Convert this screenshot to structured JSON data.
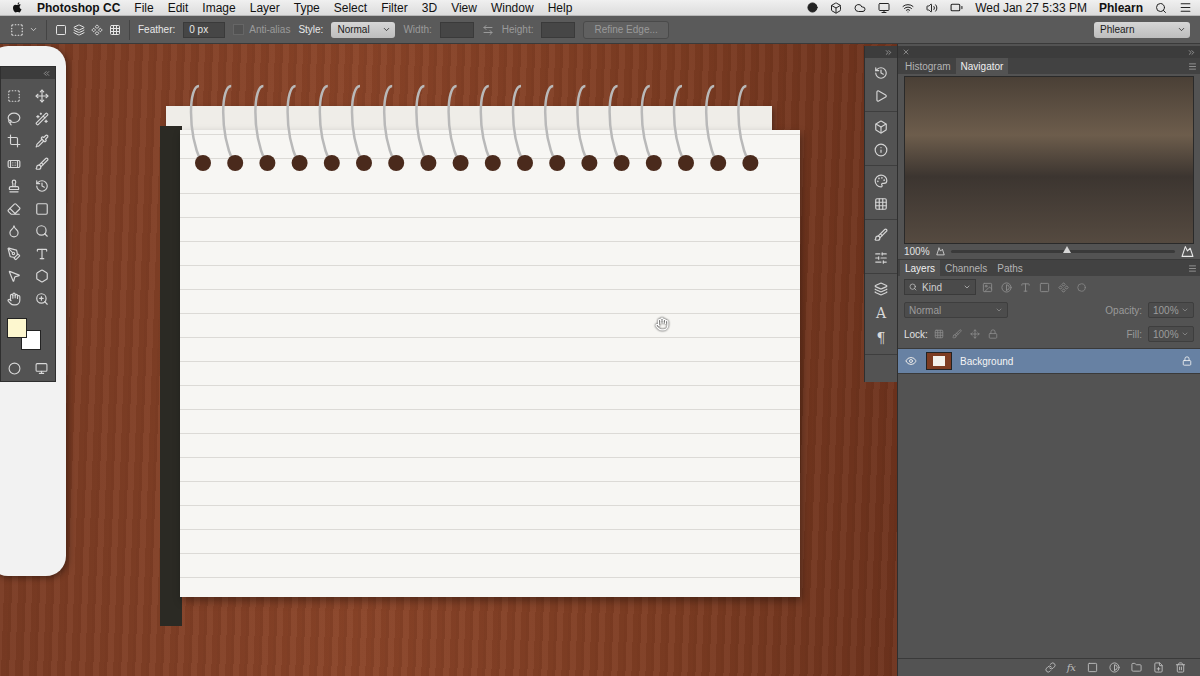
{
  "menu_bar": {
    "app": "Photoshop CC",
    "items": [
      "File",
      "Edit",
      "Image",
      "Layer",
      "Type",
      "Select",
      "Filter",
      "3D",
      "View",
      "Window",
      "Help"
    ],
    "clock": "Wed Jan 27 5:33 PM",
    "user": "Phlearn"
  },
  "options_bar": {
    "feather_label": "Feather:",
    "feather_value": "0 px",
    "anti_alias": {
      "label": "Anti-alias",
      "checked": false,
      "disabled": true
    },
    "style_label": "Style:",
    "style_value": "Normal",
    "width_label": "Width:",
    "height_label": "Height:",
    "refine_edge": {
      "label": "Refine Edge...",
      "disabled": true
    },
    "workspace": "Phlearn"
  },
  "tool_panel": {
    "swatches": [
      {
        "name": "foreground",
        "color": "#fdf7cf"
      },
      {
        "name": "background",
        "color": "#ffffff"
      }
    ]
  },
  "dock": {
    "glyphs": [
      "A",
      "¶"
    ]
  },
  "navigator_panel": {
    "tabs": [
      {
        "label": "Histogram",
        "selected": false
      },
      {
        "label": "Navigator",
        "selected": true
      }
    ],
    "zoom": "100%",
    "level": 0.52
  },
  "layers_panel": {
    "tabs": [
      {
        "label": "Layers",
        "selected": true
      },
      {
        "label": "Channels",
        "selected": false
      },
      {
        "label": "Paths",
        "selected": false
      }
    ],
    "filter": "Kind",
    "blend_mode": "Normal",
    "opacity_label": "Opacity:",
    "opacity": "100%",
    "lock_label": "Lock:",
    "fill_label": "Fill:",
    "fill": "100%",
    "layers": [
      {
        "name": "Background",
        "visible": true,
        "locked": true,
        "selected": true
      }
    ],
    "fx": "fx"
  }
}
